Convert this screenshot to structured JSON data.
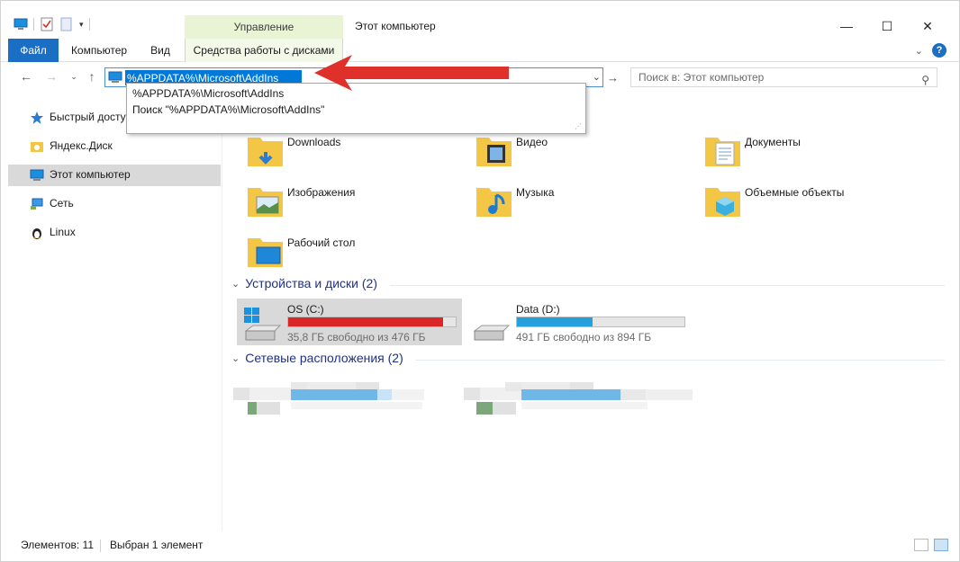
{
  "window": {
    "title": "Этот компьютер",
    "manage_tab": "Управление",
    "minimize": "—",
    "maximize": "☐",
    "close": "✕"
  },
  "ribbon": {
    "tabs": [
      {
        "label": "Файл"
      },
      {
        "label": "Компьютер"
      },
      {
        "label": "Вид"
      },
      {
        "label": "Средства работы с дисками"
      }
    ],
    "expand_icon": "chevron-down-icon",
    "help_label": "?"
  },
  "address": {
    "value": "%APPDATA%\\Microsoft\\AddIns",
    "search_placeholder": "Поиск в: Этот компьютер"
  },
  "autocomplete": {
    "items": [
      {
        "label": "%APPDATA%\\Microsoft\\AddIns"
      },
      {
        "label": "Поиск \"%APPDATA%\\Microsoft\\AddIns\""
      }
    ]
  },
  "sidebar": {
    "items": [
      {
        "label": "Быстрый доступ",
        "icon": "star-icon"
      },
      {
        "label": "Яндекс.Диск",
        "icon": "yandex-disk-icon"
      },
      {
        "label": "Этот компьютер",
        "icon": "computer-icon",
        "selected": true
      },
      {
        "label": "Сеть",
        "icon": "network-icon"
      },
      {
        "label": "Linux",
        "icon": "linux-icon"
      }
    ]
  },
  "folders": [
    {
      "label": "Downloads",
      "icon": "downloads-folder-icon"
    },
    {
      "label": "Видео",
      "icon": "video-folder-icon"
    },
    {
      "label": "Документы",
      "icon": "documents-folder-icon"
    },
    {
      "label": "Изображения",
      "icon": "pictures-folder-icon"
    },
    {
      "label": "Музыка",
      "icon": "music-folder-icon"
    },
    {
      "label": "Объемные объекты",
      "icon": "3d-objects-folder-icon"
    },
    {
      "label": "Рабочий стол",
      "icon": "desktop-folder-icon"
    }
  ],
  "groups": {
    "devices": "Устройства и диски (2)",
    "network": "Сетевые расположения (2)"
  },
  "drives": [
    {
      "name": "OS (C:)",
      "info": "35,8 ГБ свободно из 476 ГБ",
      "used_fraction": 0.925,
      "color": "#da2626",
      "selected": true
    },
    {
      "name": "Data (D:)",
      "info": "491 ГБ свободно из 894 ГБ",
      "used_fraction": 0.45,
      "color": "#26a0da",
      "selected": false
    }
  ],
  "status": {
    "count": "Элементов: 11",
    "selected": "Выбран 1 элемент"
  },
  "colors": {
    "accent": "#0078d7",
    "file_tab": "#1a6fc4",
    "manage_tab": "#e8f4d4",
    "arrow": "#e0302a",
    "group_header": "#1e3287"
  }
}
